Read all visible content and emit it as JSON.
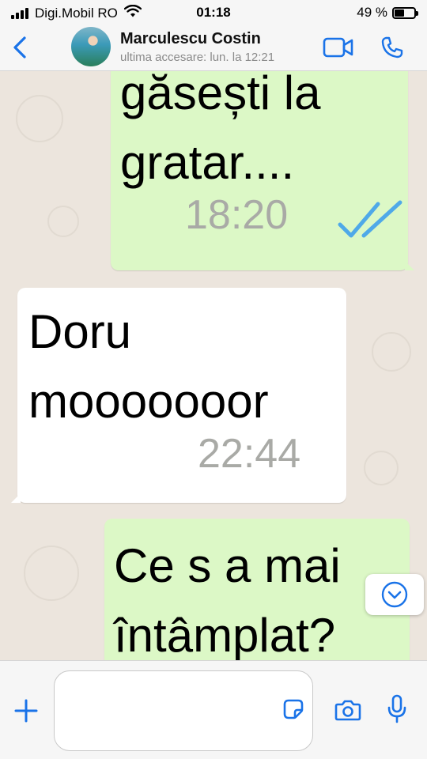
{
  "status_bar": {
    "carrier": "Digi.Mobil RO",
    "time": "01:18",
    "battery": "49 %",
    "battery_level": 0.49
  },
  "header": {
    "contact_name": "Marculescu Costin",
    "last_seen": "ultima accesare: lun. la 12:21",
    "icons": {
      "back": "chevron-left-icon",
      "video": "video-camera-icon",
      "call": "phone-icon"
    }
  },
  "messages": [
    {
      "direction": "outgoing",
      "lines": [
        "găsești la",
        "gratar...."
      ],
      "time": "18:20",
      "status": "read"
    },
    {
      "direction": "incoming",
      "lines": [
        "Doru",
        "mooooooor"
      ],
      "time": "22:44"
    },
    {
      "direction": "outgoing",
      "lines": [
        "Ce s a mai",
        "întâmplat?"
      ]
    }
  ],
  "input": {
    "value": "",
    "icons": {
      "plus": "plus-icon",
      "sticker": "sticker-icon",
      "camera": "camera-icon",
      "mic": "microphone-icon",
      "scroll": "chevron-down-circle-icon"
    }
  },
  "colors": {
    "accent": "#1a73e8",
    "outgoing_bubble": "#dcf8c6",
    "incoming_bubble": "#ffffff",
    "read_ticks": "#4fa9e8",
    "chat_background": "#ece5dd"
  }
}
